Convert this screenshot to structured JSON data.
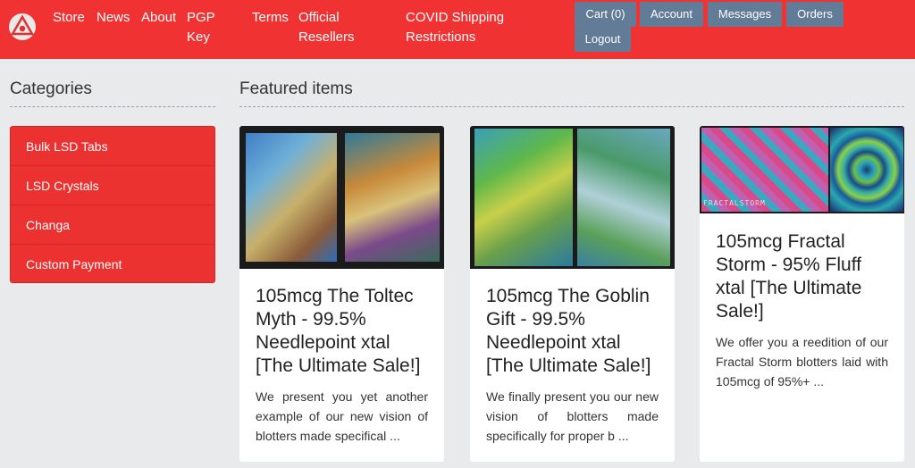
{
  "nav": {
    "links": [
      "Store",
      "News",
      "About",
      "PGP\nKey",
      "Terms",
      "Official\nResellers",
      "COVID Shipping\nRestrictions"
    ],
    "buttons": [
      "Cart (0)",
      "Account",
      "Messages",
      "Orders",
      "Logout"
    ]
  },
  "sidebar": {
    "title": "Categories",
    "items": [
      "Bulk LSD Tabs",
      "LSD Crystals",
      "Changa",
      "Custom Payment"
    ]
  },
  "featured": {
    "title": "Featured items",
    "items": [
      {
        "title": "105mcg The Toltec Myth - 99.5% Needlepoint xtal [The Ultimate Sale!]",
        "desc": "We present you yet another example of our new vision of blotters made specifical ..."
      },
      {
        "title": "105mcg The Goblin Gift - 99.5% Needlepoint xtal [The Ultimate Sale!]",
        "desc": "We finally present you our new vision of blotters made specifically for proper b ..."
      },
      {
        "title": "105mcg Fractal Storm - 95% Fluff xtal [The Ultimate Sale!]",
        "desc": "We offer you a reedition of our Fractal Storm blotters laid with 105mcg of 95%+ ...",
        "image_caption": "FRACTALSTORM"
      }
    ]
  },
  "colors": {
    "navbar": "#f03232",
    "button": "#627b97",
    "category_bg": "#ec3131",
    "page_bg": "#e9eaec"
  }
}
